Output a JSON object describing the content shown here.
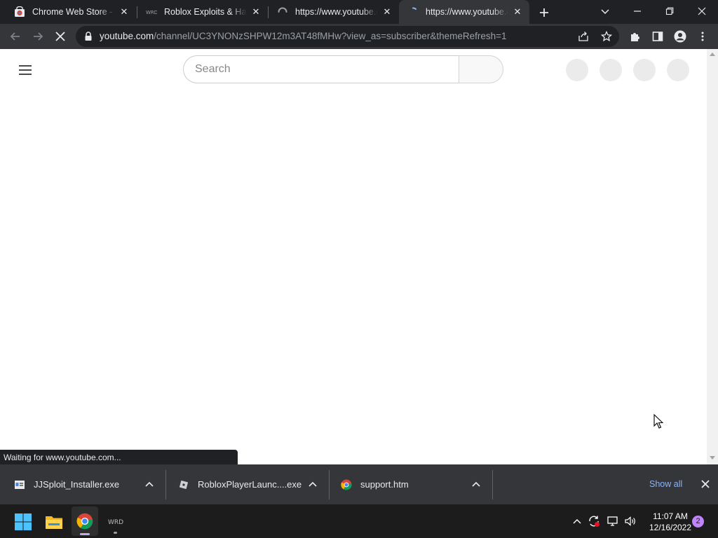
{
  "browser": {
    "tabs": [
      {
        "title": "Chrome Web Store - Extensions",
        "icon": "chrome-web-store-icon",
        "active": false
      },
      {
        "title": "Roblox Exploits & Hacks",
        "icon": "wrd-site-icon",
        "active": false
      },
      {
        "title": "https://www.youtube.com/",
        "icon": "loading-spinner-icon",
        "active": false
      },
      {
        "title": "https://www.youtube.com/",
        "icon": "loading-spinner-icon",
        "active": true
      }
    ],
    "address": {
      "host": "youtube.com",
      "path": "/channel/UC3YNONzSHPW12m3AT48fMHw?view_as=subscriber&themeRefresh=1"
    },
    "status_text": "Waiting for www.youtube.com..."
  },
  "youtube": {
    "search_placeholder": "Search"
  },
  "downloads": {
    "items": [
      {
        "name": "JJSploit_Installer.exe",
        "icon": "installer-file-icon"
      },
      {
        "name": "RobloxPlayerLaunc....exe",
        "icon": "roblox-file-icon"
      },
      {
        "name": "support.htm",
        "icon": "chrome-file-icon"
      }
    ],
    "show_all": "Show all"
  },
  "taskbar": {
    "time": "11:07 AM",
    "date": "12/16/2022",
    "notification_count": "2"
  },
  "colors": {
    "tab_strip": "#202124",
    "toolbar": "#35363a",
    "link_blue": "#8ab4f8",
    "taskbar": "#1c1c1c"
  }
}
